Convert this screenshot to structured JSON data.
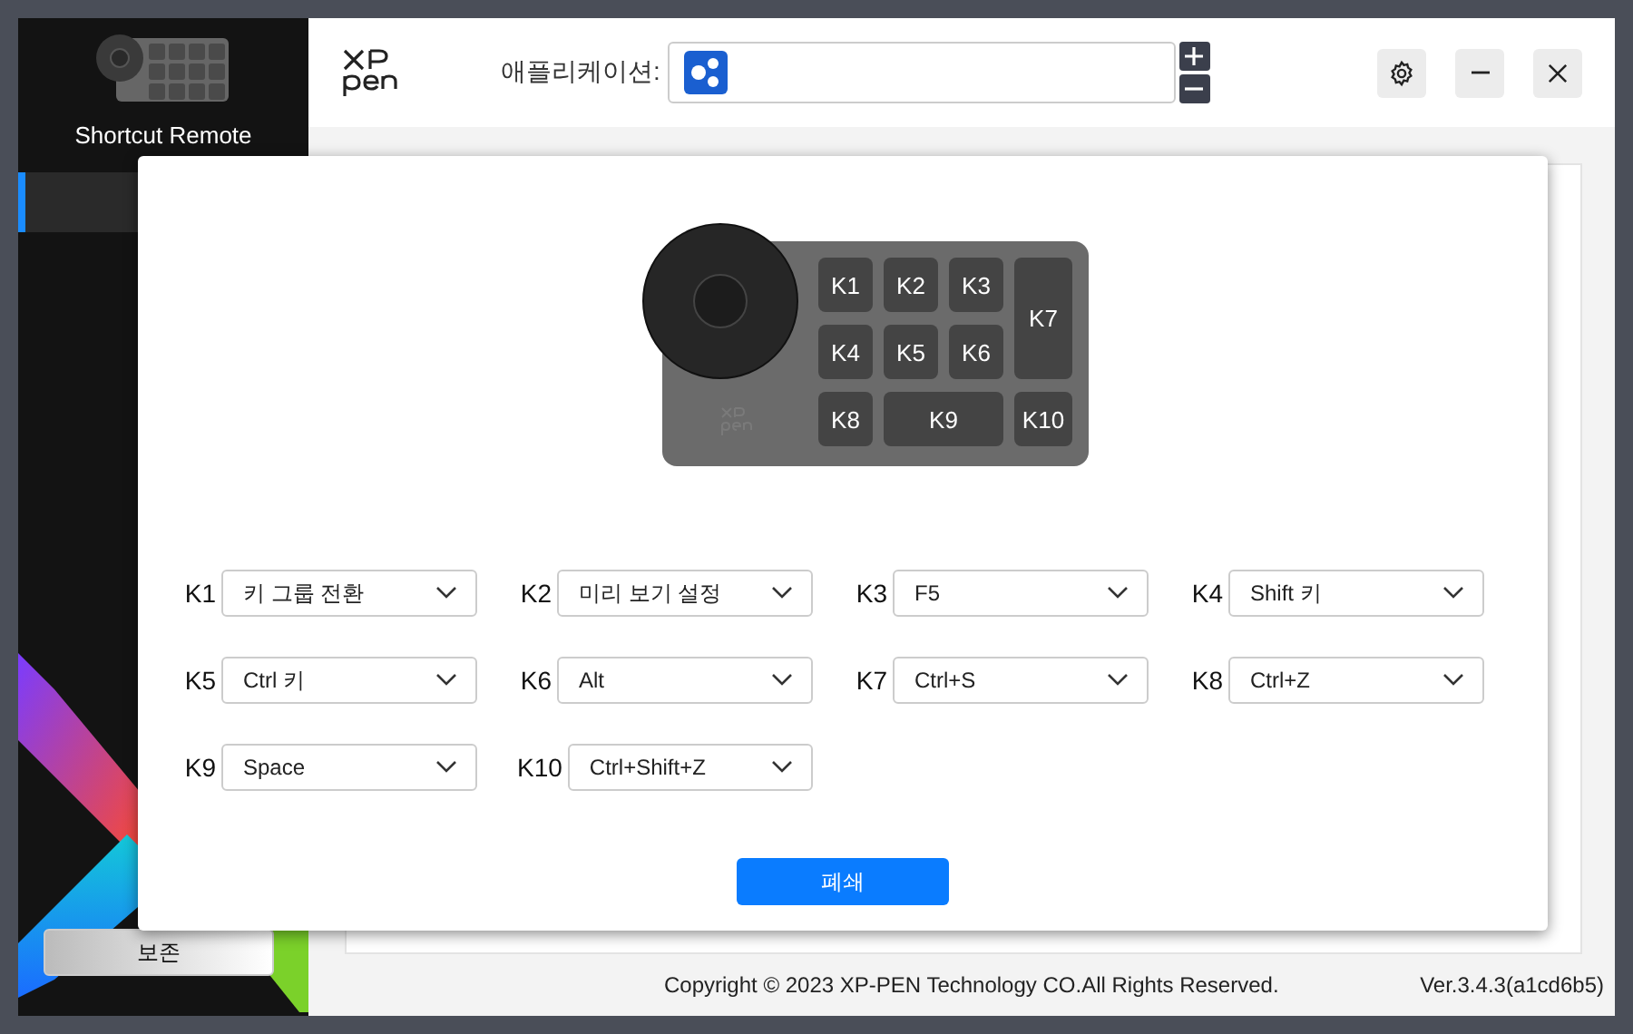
{
  "sidebar": {
    "device_name": "Shortcut Remote",
    "save_button": "보존"
  },
  "header": {
    "app_label": "애플리케이션:"
  },
  "dialog": {
    "device_keys": [
      "K1",
      "K2",
      "K3",
      "K7",
      "K4",
      "K5",
      "K6",
      "K8",
      "K9",
      "K10"
    ],
    "mappings": [
      {
        "key": "K1",
        "value": "키 그룹 전환"
      },
      {
        "key": "K2",
        "value": "미리 보기 설정"
      },
      {
        "key": "K3",
        "value": "F5"
      },
      {
        "key": "K4",
        "value": "Shift 키"
      },
      {
        "key": "K5",
        "value": "Ctrl 키"
      },
      {
        "key": "K6",
        "value": "Alt"
      },
      {
        "key": "K7",
        "value": "Ctrl+S"
      },
      {
        "key": "K8",
        "value": "Ctrl+Z"
      },
      {
        "key": "K9",
        "value": "Space"
      },
      {
        "key": "K10",
        "value": "Ctrl+Shift+Z"
      }
    ],
    "close_button": "폐쇄"
  },
  "footer": {
    "copyright": "Copyright © 2023  XP-PEN Technology CO.All Rights Reserved.",
    "version": "Ver.3.4.3(a1cd6b5)"
  }
}
